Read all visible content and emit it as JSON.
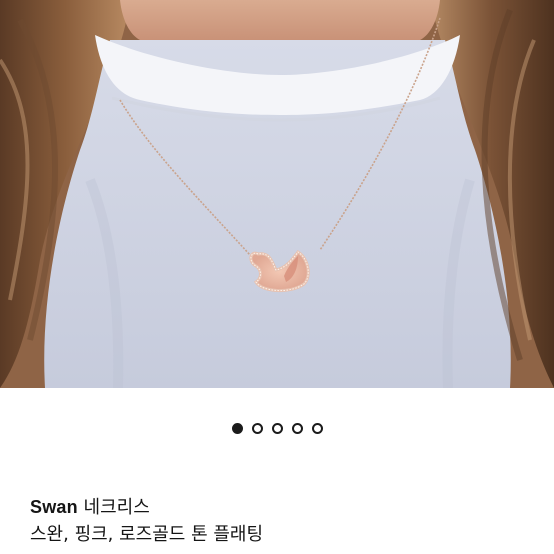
{
  "product": {
    "image_alt": "Swan necklace worn with light blue-grey top",
    "brand": "Swan",
    "title_rest": " 네크리스",
    "subtitle": "스완, 핑크, 로즈골드 톤 플래팅"
  },
  "carousel": {
    "total": 5,
    "active_index": 0
  },
  "colors": {
    "text": "#151515",
    "dot": "#1b1b1b",
    "background": "#ffffff"
  }
}
